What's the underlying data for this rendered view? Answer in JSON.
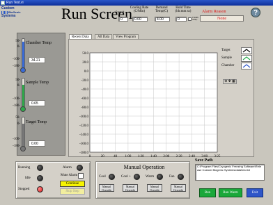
{
  "window": {
    "title": "Run Test.vi"
  },
  "logo": {
    "line1": "Custom",
    "line2": "BioGenic",
    "line3": "Systems"
  },
  "app_title": "Run Screen",
  "header": {
    "step_label": "Step #",
    "step_value": "0",
    "cooling_label": "Cooling Rate (C/Min)",
    "cooling_value": "0.00",
    "demand_label": "Demand Temp(C)",
    "demand_value": "4.00",
    "hold_label": "Hold Time (hh:mm:ss)",
    "hold_value": "0",
    "chamb_label": "Chamb. Samp."
  },
  "alarm": {
    "label": "Alarm Reason",
    "value": "None"
  },
  "thermometers": [
    {
      "title": "Chamber Temp",
      "value": "34.21",
      "scale": [
        "50-",
        "0-",
        "-100-",
        "-180-"
      ],
      "fill_color": "#3a6bd6",
      "fill_fraction": 0.9
    },
    {
      "title": "Sample Temp",
      "value": "0.65",
      "scale": [
        "50-",
        "0-",
        "-100-",
        "-180-"
      ],
      "fill_color": "#2fa84a",
      "fill_fraction": 0.78
    },
    {
      "title": "Target Temp",
      "value": "0.00",
      "scale": [
        "50-",
        "0-",
        "-100-",
        "-180-"
      ],
      "fill_color": "#777777",
      "fill_fraction": 0.78
    }
  ],
  "tabs": [
    "Recent Data",
    "All Data",
    "View Program"
  ],
  "chart_data": {
    "type": "line",
    "title": "",
    "xlabel": "",
    "ylabel": "",
    "x_ticks": [
      "0",
      "20",
      "40",
      "1:00",
      "1:20",
      "1:40",
      "2:00",
      "2:20",
      "2:40",
      "3:00",
      "3:25"
    ],
    "y_ticks": [
      "50.0",
      "20.0",
      "0.0",
      "-20.0",
      "-40.0",
      "-60.0",
      "-80.0",
      "-100.0",
      "-120.0",
      "-140.0",
      "-160.0",
      "-180.0"
    ],
    "ylim": [
      -180,
      50
    ],
    "grid": true,
    "series": [
      {
        "name": "Target",
        "color": "#000000",
        "values": []
      },
      {
        "name": "Sample",
        "color": "#22a84a",
        "values": []
      },
      {
        "name": "Chamber",
        "color": "#2f56c8",
        "values": []
      }
    ],
    "legend_position": "right"
  },
  "status": {
    "running_label": "Running",
    "idle_label": "Idle",
    "stopped_label": "Stopped",
    "alarm_label": "Alarm",
    "mute_label": "Mute Alarm",
    "continue_label": "Continue",
    "skip_label": "Skip Step"
  },
  "manual": {
    "title": "Manual Operation",
    "cool_label": "Cool",
    "coolplus_label": "Cool +",
    "warm_label": "Warm",
    "fan_label": "Fan",
    "override_label": "Manual Override"
  },
  "save": {
    "label": "Save Path",
    "path": "C:\\Program Files\\Cryogenic Freezing Software\\Release Custom Biogenic Systems\\data\\test.txt",
    "run_label": "Run",
    "runwarm_label": "Run Warm",
    "exit_label": "Exit"
  },
  "colors": {
    "alarm_red": "#dd1111",
    "run_green": "#1aa83a",
    "exit_blue": "#2f56c8"
  }
}
